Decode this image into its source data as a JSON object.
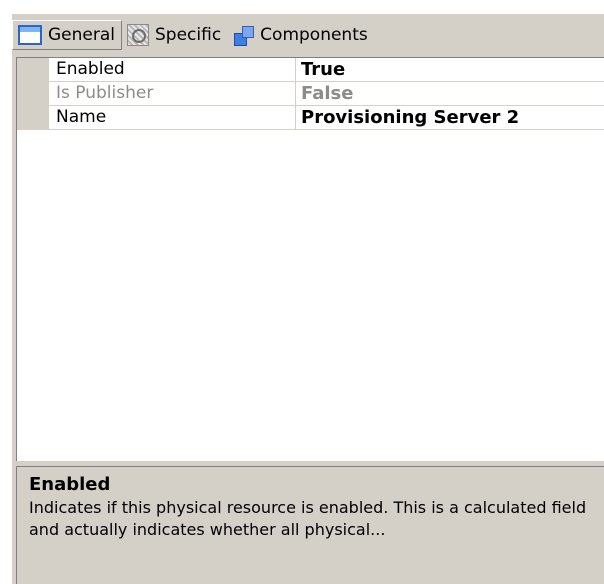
{
  "toolbar": {
    "tabs": [
      {
        "label": "General",
        "icon": "general-icon",
        "active": true
      },
      {
        "label": "Specific",
        "icon": "specific-icon",
        "active": false
      },
      {
        "label": "Components",
        "icon": "components-icon",
        "active": false
      }
    ]
  },
  "properties": [
    {
      "name": "Enabled",
      "value": "True",
      "disabled": false
    },
    {
      "name": "Is Publisher",
      "value": "False",
      "disabled": true
    },
    {
      "name": "Name",
      "value": "Provisioning Server 2",
      "disabled": false
    }
  ],
  "description": {
    "title": "Enabled",
    "text": "Indicates if this physical resource is enabled. This is a calculated field and actually indicates whether all physical..."
  },
  "colors": {
    "panel_bg": "#d4d0c8",
    "grid_bg": "#ffffff",
    "disabled_text": "#8c8c8c",
    "tab_icon_blue": "#2a66c8"
  }
}
